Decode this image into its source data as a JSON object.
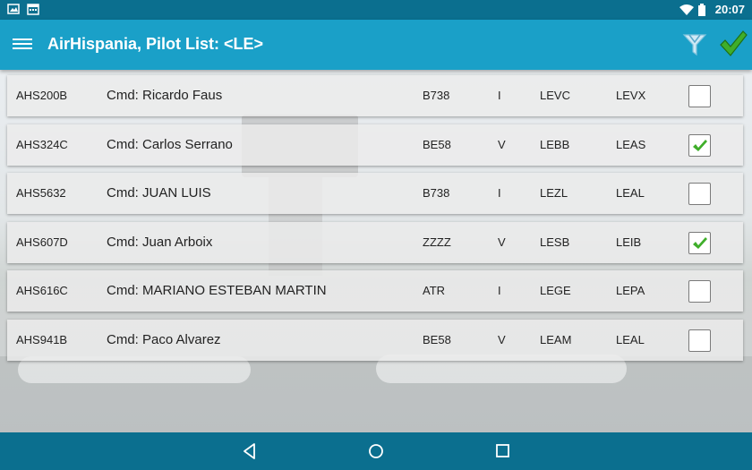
{
  "status_bar": {
    "time": "20:07",
    "icons": [
      "image-icon",
      "calendar-icon",
      "wifi-icon",
      "battery-icon"
    ]
  },
  "app_bar": {
    "title": "AirHispania, Pilot List: <LE>",
    "actions": [
      "filter-icon",
      "checkmark-icon"
    ]
  },
  "colors": {
    "status_bar": "#0b6f8f",
    "app_bar": "#1aa0c8",
    "check_green": "#3fae2a"
  },
  "rows": [
    {
      "flight": "AHS200B",
      "pilot": "Cmd: Ricardo Faus",
      "aircraft": "B738",
      "rules": "I",
      "departure": "LEVC",
      "arrival": "LEVX",
      "checked": false
    },
    {
      "flight": "AHS324C",
      "pilot": "Cmd: Carlos Serrano",
      "aircraft": "BE58",
      "rules": "V",
      "departure": "LEBB",
      "arrival": "LEAS",
      "checked": true
    },
    {
      "flight": "AHS5632",
      "pilot": "Cmd: JUAN LUIS",
      "aircraft": "B738",
      "rules": "I",
      "departure": "LEZL",
      "arrival": "LEAL",
      "checked": false
    },
    {
      "flight": "AHS607D",
      "pilot": "Cmd: Juan Arboix",
      "aircraft": "ZZZZ",
      "rules": "V",
      "departure": "LESB",
      "arrival": "LEIB",
      "checked": true
    },
    {
      "flight": "AHS616C",
      "pilot": "Cmd: MARIANO ESTEBAN MARTIN",
      "aircraft": "ATR",
      "rules": "I",
      "departure": "LEGE",
      "arrival": "LEPA",
      "checked": false
    },
    {
      "flight": "AHS941B",
      "pilot": "Cmd: Paco Alvarez",
      "aircraft": "BE58",
      "rules": "V",
      "departure": "LEAM",
      "arrival": "LEAL",
      "checked": false
    }
  ],
  "nav_bar": {
    "buttons": [
      "back-icon",
      "home-icon",
      "recents-icon"
    ]
  }
}
